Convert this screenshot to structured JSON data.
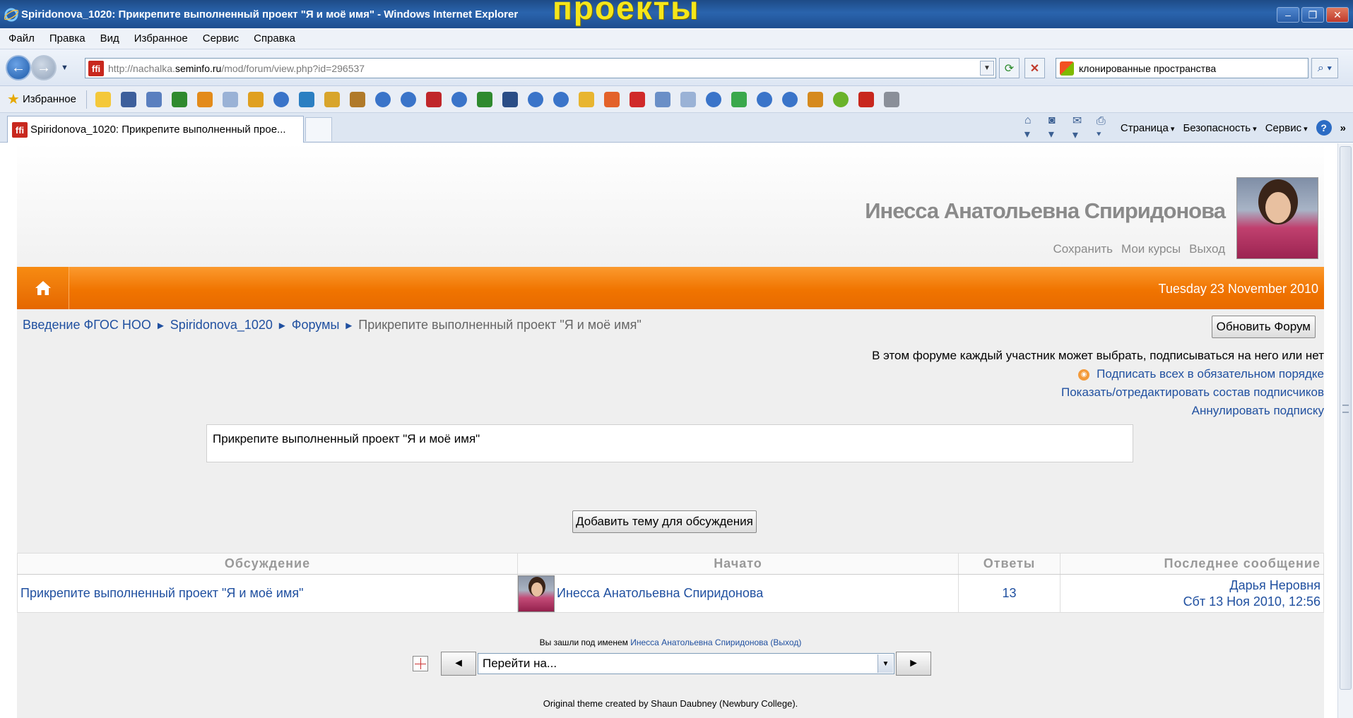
{
  "window": {
    "title": "Spiridonova_1020: Прикрепите выполненный проект \"Я и моё имя\" - Windows Internet Explorer",
    "overlay_text": "проекты"
  },
  "menu": [
    "Файл",
    "Правка",
    "Вид",
    "Избранное",
    "Сервис",
    "Справка"
  ],
  "address": {
    "url_prefix": "http://nachalka.",
    "url_host": "seminfo.ru",
    "url_path": "/mod/forum/view.php?id=296537",
    "favicon": "ffi",
    "search_text": "клонированные пространства"
  },
  "favorites": {
    "label": "Избранное"
  },
  "tab": {
    "title": "Spiridonova_1020: Прикрепите выполненный прое..."
  },
  "command_bar": [
    "Страница",
    "Безопасность",
    "Сервис"
  ],
  "header": {
    "user_name": "Инесса Анатольевна Спиридонова",
    "links": [
      "Сохранить",
      "Мои курсы",
      "Выход"
    ]
  },
  "date": "Tuesday 23 November 2010",
  "breadcrumb": {
    "items": [
      "Введение ФГОС НОО",
      "Spiridonova_1020",
      "Форумы"
    ],
    "current": "Прикрепите выполненный проект \"Я и моё имя\"",
    "separator": "►"
  },
  "buttons": {
    "update_forum": "Обновить Форум",
    "add_topic": "Добавить тему для обсуждения"
  },
  "subscription": {
    "info": "В этом форуме каждый участник может выбрать, подписываться на него или нет",
    "force_subscribe": "Подписать всех в обязательном порядке",
    "show_edit": "Показать/отредактировать состав подписчиков",
    "unsubscribe": "Аннулировать подписку"
  },
  "intro": "Прикрепите выполненный проект \"Я и моё имя\"",
  "table": {
    "headers": [
      "Обсуждение",
      "Начато",
      "Ответы",
      "Последнее сообщение"
    ],
    "rows": [
      {
        "topic": "Прикрепите выполненный проект \"Я и моё имя\"",
        "started_by": "Инесса Анатольевна Спиридонова",
        "replies": "13",
        "last_author": "Дарья Неровня",
        "last_date": "Сбт 13 Ноя 2010, 12:56"
      }
    ]
  },
  "footer": {
    "logged_in_prefix": "Вы зашли под именем",
    "logged_in_name": "Инесса Анатольевна Спиридонова",
    "logout": "(Выход)",
    "jump_placeholder": "Перейти на...",
    "credits": "Original theme created by Shaun Daubney (Newbury College)."
  },
  "colors": {
    "accent_orange": "#f07400",
    "link_blue": "#2050a0"
  }
}
